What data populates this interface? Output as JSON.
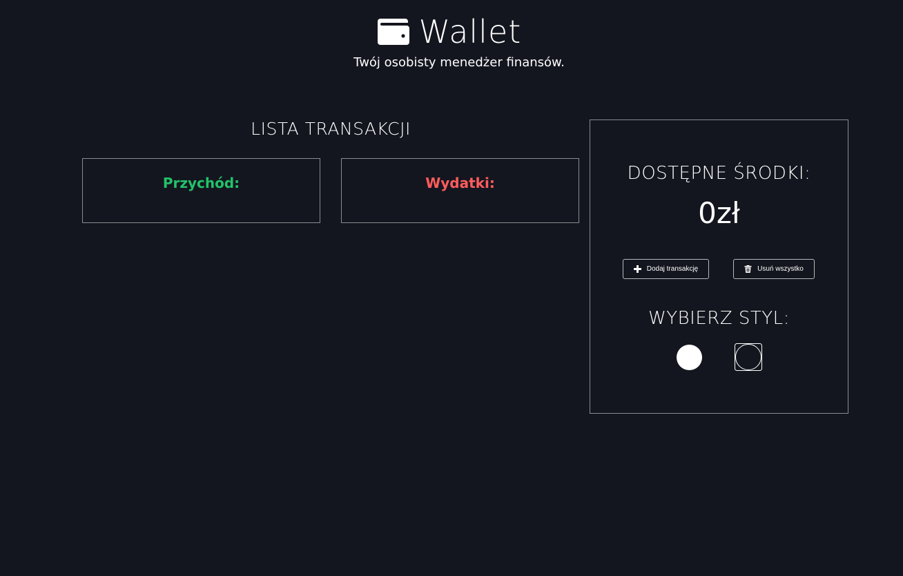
{
  "header": {
    "title": "Wallet",
    "icon": "wallet-icon",
    "subtitle": "Twój osobisty menedżer finansów."
  },
  "transactions": {
    "heading": "LISTA TRANSAKCJI",
    "income_label": "Przychód:",
    "expenses_label": "Wydatki:"
  },
  "panel": {
    "funds_label": "DOSTĘPNE ŚRODKI:",
    "funds_value": "0zł",
    "add_button_label": "Dodaj transakcję",
    "add_button_icon": "plus-icon",
    "clear_button_label": "Usuń wszystko",
    "clear_button_icon": "trash-icon",
    "style_label": "WYBIERZ STYL:",
    "style_options": [
      "light-style",
      "dark-style"
    ]
  },
  "colors": {
    "background": "#14161f",
    "income": "#22c26a",
    "expenses": "#ff5c5c",
    "border": "#8a8b92",
    "text": "#ffffff"
  }
}
